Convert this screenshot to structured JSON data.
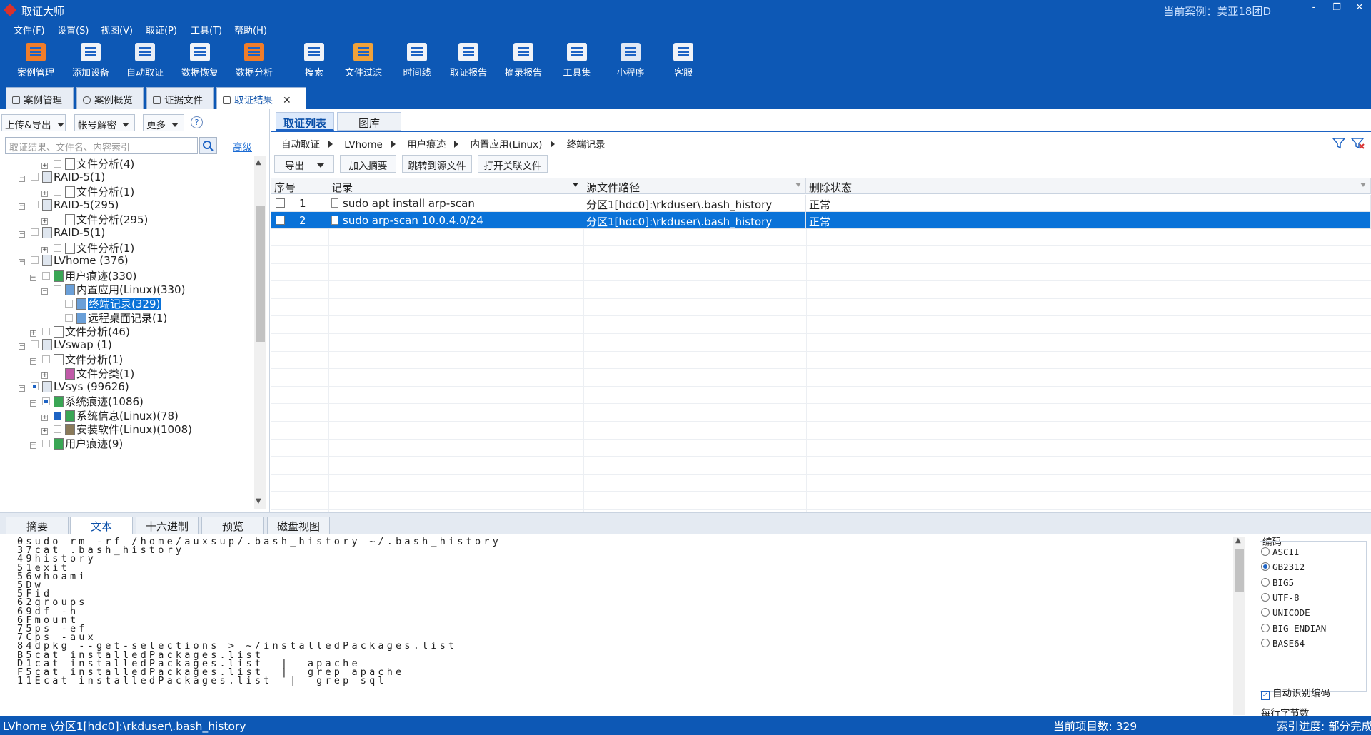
{
  "app": {
    "title": "取证大师",
    "case_label": "当前案例：美亚18团D"
  },
  "window_buttons": [
    "-",
    "❐",
    "✕"
  ],
  "menu": [
    "文件(F)",
    "设置(S)",
    "视图(V)",
    "取证(P)",
    "工具(T)",
    "帮助(H)"
  ],
  "toolbar": [
    {
      "label": "案例管理",
      "icon": "case-management-icon",
      "color": "#f07d2a"
    },
    {
      "label": "添加设备",
      "icon": "add-device-icon",
      "color": "#f0f3f8"
    },
    {
      "label": "自动取证",
      "icon": "auto-forensics-icon",
      "color": "#e8eef7"
    },
    {
      "label": "数据恢复",
      "icon": "data-recovery-icon",
      "color": "#f0f3f8"
    },
    {
      "label": "数据分析",
      "icon": "data-analysis-icon",
      "color": "#f07d2a"
    },
    {
      "label": "搜索",
      "icon": "search-icon",
      "color": "#f0f3f8"
    },
    {
      "label": "文件过滤",
      "icon": "file-filter-icon",
      "color": "#f0a23a"
    },
    {
      "label": "时间线",
      "icon": "timeline-icon",
      "color": "#f0f3f8"
    },
    {
      "label": "取证报告",
      "icon": "report-icon",
      "color": "#f0f3f8"
    },
    {
      "label": "摘录报告",
      "icon": "excerpt-report-icon",
      "color": "#f0f3f8"
    },
    {
      "label": "工具集",
      "icon": "toolset-icon",
      "color": "#f0f3f8"
    },
    {
      "label": "小程序",
      "icon": "miniapp-icon",
      "color": "#e0e8f5"
    },
    {
      "label": "客服",
      "icon": "support-icon",
      "color": "#f0f3f8"
    }
  ],
  "doc_tabs": [
    {
      "label": "案例管理"
    },
    {
      "label": "案例概览"
    },
    {
      "label": "证据文件"
    },
    {
      "label": "取证结果",
      "close": "✕"
    }
  ],
  "left": {
    "dropdowns": [
      "上传&导出",
      "帐号解密",
      "更多"
    ],
    "help": "?",
    "search_placeholder": "取证结果、文件名、内容索引",
    "advanced": "高级",
    "tree": [
      {
        "label": "文件分析(4)",
        "toggle": "+"
      },
      {
        "label": "RAID-5(1)",
        "toggle": "−"
      },
      {
        "label": "文件分析(1)",
        "toggle": "+"
      },
      {
        "label": "RAID-5(295)",
        "toggle": "−"
      },
      {
        "label": "文件分析(295)",
        "toggle": "+"
      },
      {
        "label": "RAID-5(1)",
        "toggle": "−"
      },
      {
        "label": "文件分析(1)",
        "toggle": "+"
      },
      {
        "label": "LVhome (376)",
        "toggle": "−"
      },
      {
        "label": "用户痕迹(330)",
        "toggle": "−"
      },
      {
        "label": "内置应用(Linux)(330)",
        "toggle": "−"
      },
      {
        "label": "终端记录(329)"
      },
      {
        "label": "远程桌面记录(1)"
      },
      {
        "label": "文件分析(46)",
        "toggle": "+"
      },
      {
        "label": "LVswap (1)",
        "toggle": "−"
      },
      {
        "label": "文件分析(1)",
        "toggle": "−"
      },
      {
        "label": "文件分类(1)",
        "toggle": "+"
      },
      {
        "label": "LVsys (99626)",
        "toggle": "−"
      },
      {
        "label": "系统痕迹(1086)",
        "toggle": "−"
      },
      {
        "label": "系统信息(Linux)(78)",
        "toggle": "+"
      },
      {
        "label": "安装软件(Linux)(1008)",
        "toggle": "+"
      },
      {
        "label": "用户痕迹(9)",
        "toggle": "−"
      }
    ]
  },
  "right": {
    "tabs": [
      "取证列表",
      "图库"
    ],
    "breadcrumb": [
      "自动取证",
      "LVhome",
      "用户痕迹",
      "内置应用(Linux)",
      "终端记录"
    ],
    "actions": [
      "导出",
      "加入摘要",
      "跳转到源文件",
      "打开关联文件"
    ],
    "columns": [
      "序号",
      "记录",
      "源文件路径",
      "删除状态"
    ],
    "rows": [
      {
        "no": "1",
        "record": "sudo apt install arp-scan",
        "path": "分区1[hdc0]:\\rkduser\\.bash_history",
        "status": "正常"
      },
      {
        "no": "2",
        "record": "sudo arp-scan 10.0.4.0/24",
        "path": "分区1[hdc0]:\\rkduser\\.bash_history",
        "status": "正常"
      }
    ]
  },
  "bottom": {
    "tabs": [
      "摘要",
      "文本",
      "十六进制",
      "预览",
      "磁盘视图"
    ],
    "text_lines": [
      "0sudo rm -rf /home/auxsup/.bash_history ~/.bash_history",
      "37cat .bash_history",
      "49history",
      "51exit",
      "56whoami",
      "5Dw",
      "5Fid",
      "62groups",
      "69df -h",
      "6Fmount",
      "75ps -ef",
      "7Cps -aux",
      "84dpkg --get-selections > ~/installedPackages.list",
      "B5cat installedPackages.list",
      "D1cat installedPackages.list  |  apache",
      "F5cat installedPackages.list  |  grep apache",
      "11Ecat installedPackages.list  |  grep sql"
    ],
    "encoding": {
      "title": "编码",
      "options": [
        "ASCII",
        "GB2312",
        "BIG5",
        "UTF-8",
        "UNICODE",
        "BIG ENDIAN",
        "BASE64"
      ],
      "selected": "GB2312",
      "auto_detect": "自动识别编码",
      "bytes_per_line": "每行字节数"
    }
  },
  "status": {
    "path": "LVhome \\分区1[hdc0]:\\rkduser\\.bash_history",
    "count": "当前项目数: 329",
    "index": "索引进度: 部分完成"
  }
}
